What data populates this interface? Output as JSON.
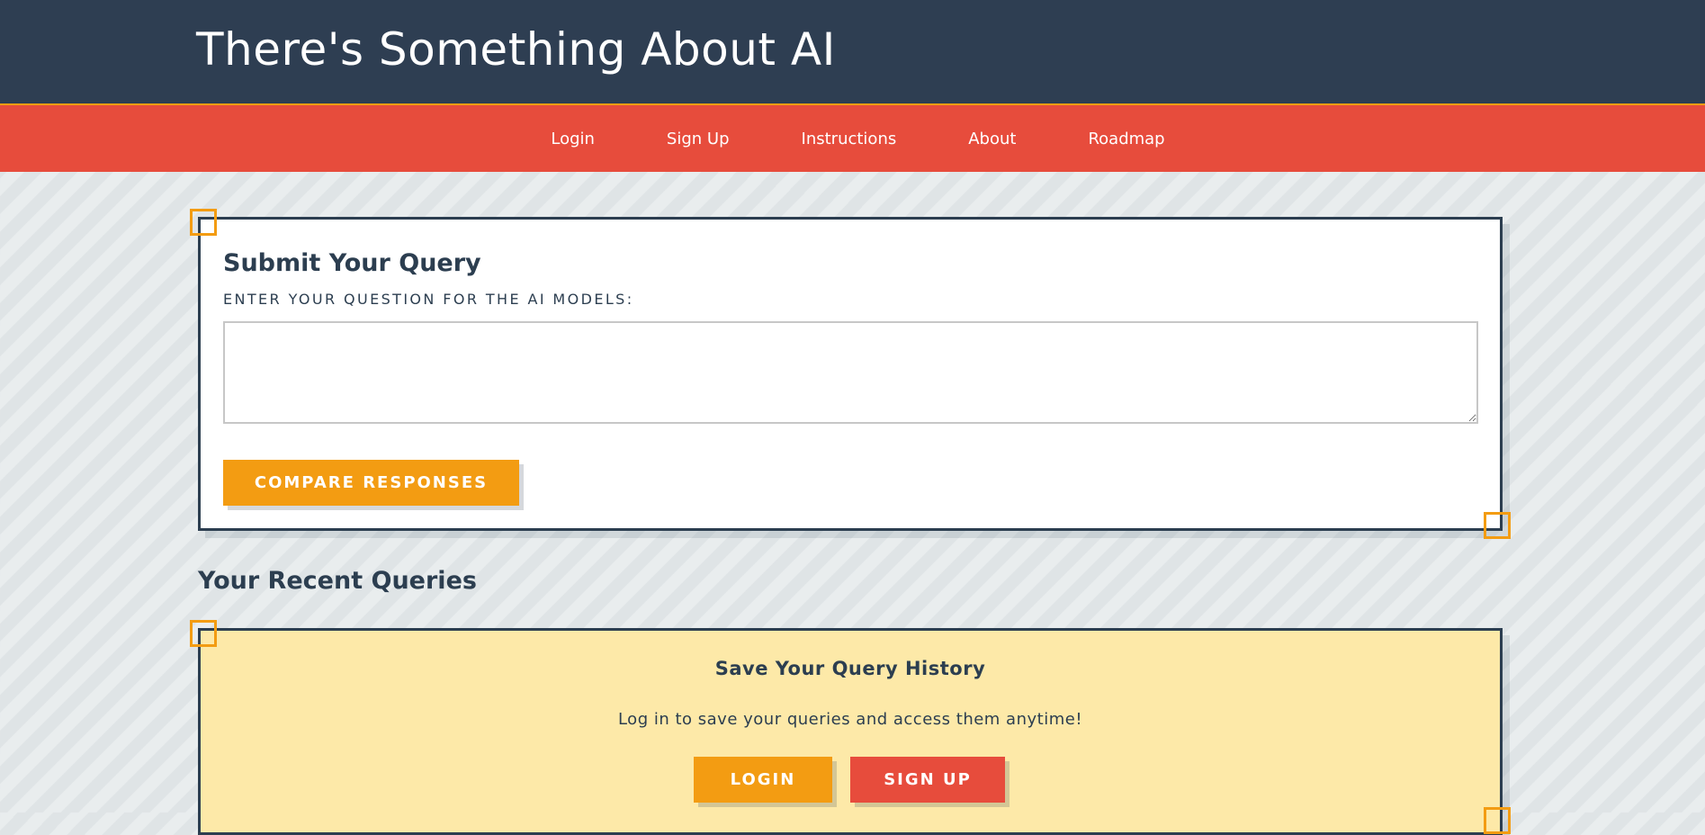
{
  "header": {
    "title": "There's Something About AI"
  },
  "nav": {
    "items": [
      {
        "label": "Login"
      },
      {
        "label": "Sign Up"
      },
      {
        "label": "Instructions"
      },
      {
        "label": "About"
      },
      {
        "label": "Roadmap"
      }
    ]
  },
  "query": {
    "title": "Submit Your Query",
    "label": "ENTER YOUR QUESTION FOR THE AI MODELS:",
    "input_value": "",
    "compare_label": "COMPARE RESPONSES"
  },
  "recent": {
    "title": "Your Recent Queries",
    "card_title": "Save Your Query History",
    "card_text": "Log in to save your queries and access them anytime!",
    "login_label": "LOGIN",
    "signup_label": "SIGN UP"
  },
  "colors": {
    "header_bg": "#2e3e52",
    "nav_bg": "#e74c3c",
    "accent_orange": "#f39c12",
    "history_bg": "#fde9a8",
    "text_dark": "#2c3e50"
  }
}
